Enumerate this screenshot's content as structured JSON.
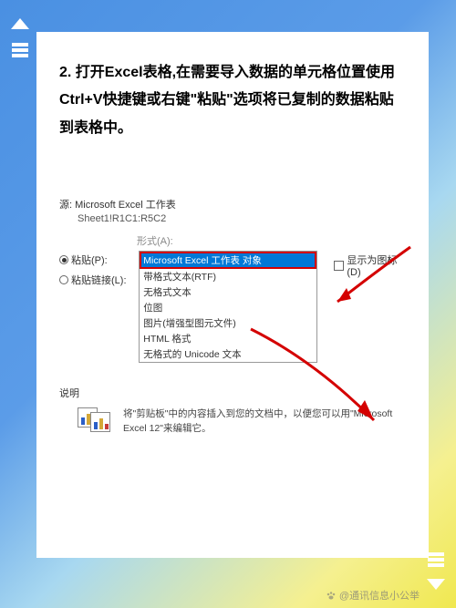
{
  "instruction": "2. 打开Excel表格,在需要导入数据的单元格位置使用Ctrl+V快捷键或右键\"粘贴\"选项将已复制的数据粘贴到表格中。",
  "dialog": {
    "source_label": "源: Microsoft Excel 工作表",
    "source_value": "Sheet1!R1C1:R5C2",
    "format_label": "形式(A):",
    "radio_paste": "粘贴(P):",
    "radio_paste_link": "粘贴链接(L):",
    "checkbox_icon": "显示为图标(D)",
    "options": [
      "Microsoft Excel 工作表 对象",
      "带格式文本(RTF)",
      "无格式文本",
      "位图",
      "图片(增强型图元文件)",
      "HTML 格式",
      "无格式的 Unicode 文本"
    ],
    "desc_label": "说明",
    "desc_text": "将\"剪贴板\"中的内容插入到您的文档中，以便您可以用\"Microsoft Excel 12\"来编辑它。"
  },
  "watermark": "@通讯信息小公举"
}
